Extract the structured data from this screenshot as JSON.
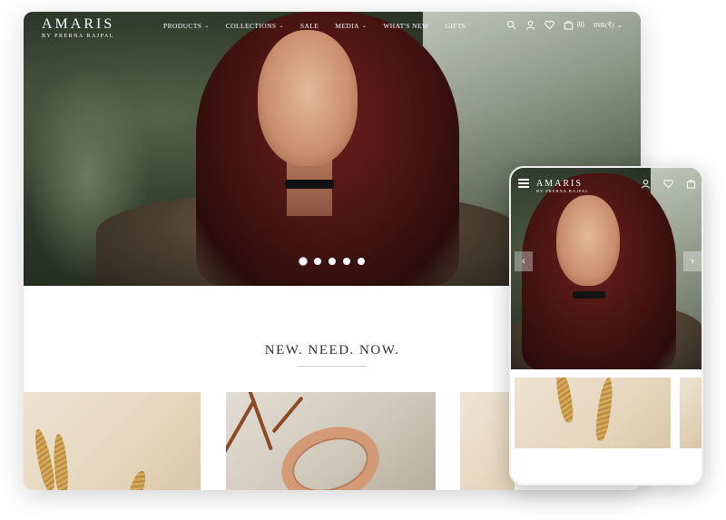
{
  "brand": {
    "name": "AMARIS",
    "tagline": "BY PRERNA RAJPAL"
  },
  "nav": {
    "items": [
      {
        "label": "PRODUCTS",
        "dropdown": true
      },
      {
        "label": "COLLECTIONS",
        "dropdown": true
      },
      {
        "label": "SALE",
        "dropdown": false
      },
      {
        "label": "MEDIA",
        "dropdown": true
      },
      {
        "label": "WHAT'S NEW",
        "dropdown": false
      },
      {
        "label": "GIFTS",
        "dropdown": false
      }
    ],
    "icons": [
      "search-icon",
      "user-icon",
      "heart-icon",
      "cart-icon"
    ],
    "cart_count": "(0)",
    "currency": "INR(₹)"
  },
  "hero": {
    "slide_count": 5,
    "active_slide": 1
  },
  "section": {
    "title": "NEW. NEED. NOW."
  },
  "mobile": {
    "brand": {
      "name": "AMARIS",
      "tagline": "BY PRERNA RAJPAL"
    },
    "icons": [
      "menu-icon",
      "user-icon",
      "heart-icon",
      "cart-icon"
    ]
  },
  "colors": {
    "background": "#ffffff",
    "title_text": "#2f2f2f",
    "nav_text": "#ffffff"
  }
}
